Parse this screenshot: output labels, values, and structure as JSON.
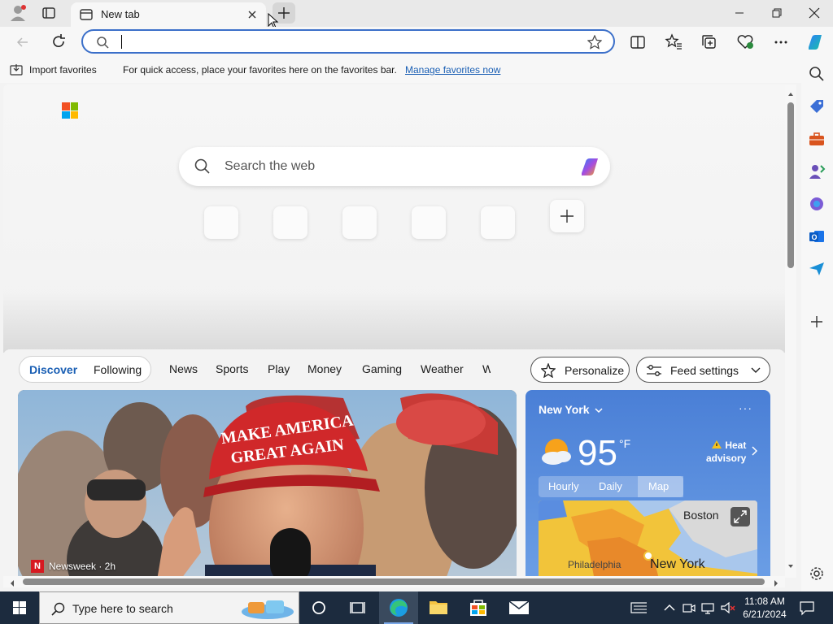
{
  "browser": {
    "tab_title": "New tab",
    "address_value": "",
    "favorites_bar": {
      "import_label": "Import favorites",
      "message": "For quick access, place your favorites here on the favorites bar.",
      "link_label": "Manage favorites now"
    }
  },
  "newtab": {
    "search_placeholder": "Search the web"
  },
  "feed": {
    "pills": [
      "Discover",
      "Following"
    ],
    "links": [
      "News",
      "Sports",
      "Play",
      "Money",
      "Gaming",
      "Weather",
      "W"
    ],
    "personalize_label": "Personalize",
    "feed_settings_label": "Feed settings",
    "news_card": {
      "source": "Newsweek · 2h",
      "source_logo": "N",
      "hat_text_line1": "MAKE AMERICA",
      "hat_text_line2": "GREAT AGAIN"
    },
    "weather": {
      "city": "New York",
      "temp": "95",
      "unit": "°F",
      "alert_line1": "Heat",
      "alert_line2": "advisory",
      "tabs": [
        "Hourly",
        "Daily",
        "Map"
      ],
      "active_tab": "Map",
      "map_labels": {
        "boston": "Boston",
        "new_york": "New York",
        "philadelphia": "Philadelphia"
      }
    }
  },
  "taskbar": {
    "search_placeholder": "Type here to search",
    "time": "11:08 AM",
    "date": "6/21/2024"
  },
  "colors": {
    "accent": "#1a5fb4",
    "taskbar": "#1c2b3e",
    "weather_bg": "#4a7fd6"
  }
}
